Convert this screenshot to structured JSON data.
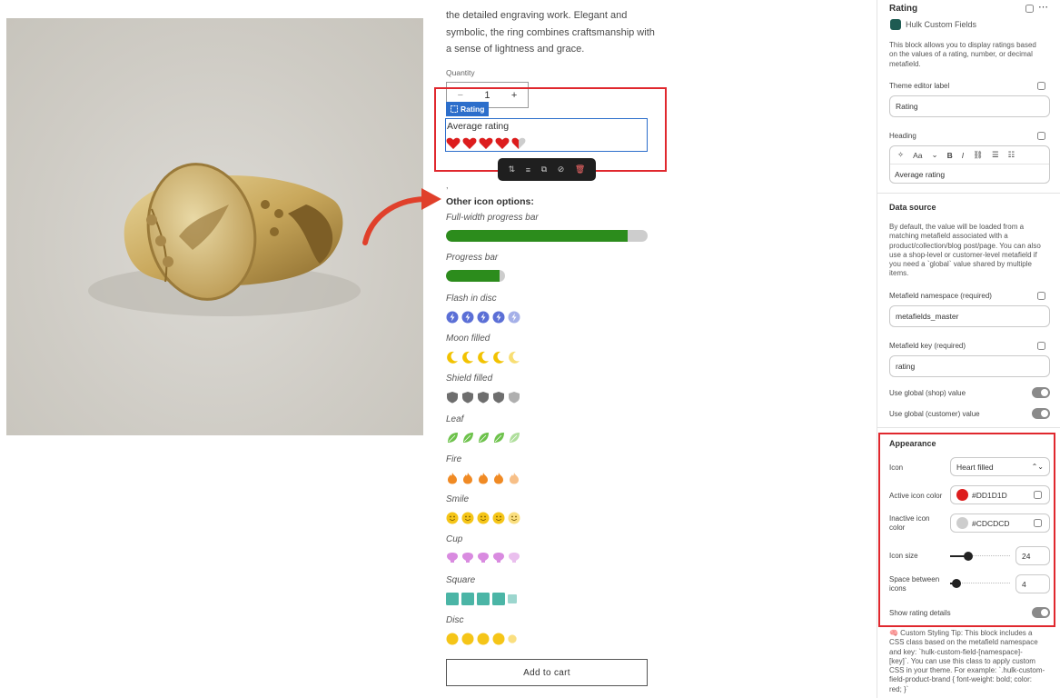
{
  "product": {
    "description_lines": [
      "the detailed engraving work. Elegant and",
      "symbolic, the ring combines craftsmanship with",
      "a sense of lightness and grace."
    ],
    "quantity_label": "Quantity",
    "quantity_value": "1",
    "minus": "−",
    "plus": "+",
    "add_to_cart": "Add to cart"
  },
  "rating_block": {
    "tag": "Rating",
    "heading": "Average rating",
    "rating_value": 4.5,
    "max": 5,
    "active_color": "#DD1D1D",
    "inactive_color": "#CDCDCD"
  },
  "other_options": {
    "heading": "Other icon options:",
    "items": [
      {
        "label": "Full-width progress bar",
        "type": "fullbar",
        "fraction": 0.9
      },
      {
        "label": "Progress bar",
        "type": "bar",
        "fraction": 0.9
      },
      {
        "label": "Flash in disc",
        "type": "flash",
        "color": "#5b6fd6"
      },
      {
        "label": "Moon filled",
        "type": "moon",
        "color": "#f2c200"
      },
      {
        "label": "Shield filled",
        "type": "shield",
        "color": "#6e6e6e"
      },
      {
        "label": "Leaf",
        "type": "leaf",
        "color": "#6dc24b"
      },
      {
        "label": "Fire",
        "type": "fire",
        "color": "#f08a24"
      },
      {
        "label": "Smile",
        "type": "smile",
        "color": "#f5c518"
      },
      {
        "label": "Cup",
        "type": "cup",
        "color": "#d98be0"
      },
      {
        "label": "Square",
        "type": "square",
        "color": "#4bb5a6"
      },
      {
        "label": "Disc",
        "type": "disc",
        "color": "#f5c518"
      }
    ]
  },
  "panel": {
    "title": "Rating",
    "app_name": "Hulk Custom Fields",
    "intro": [
      "This block allows you to display ratings based",
      "on the values of a rating, number, or decimal",
      "metafield."
    ],
    "theme_editor_label": "Theme editor label",
    "theme_editor_value": "Rating",
    "heading_label": "Heading",
    "heading_value": "Average rating",
    "rte_font_label": "Aa",
    "data_source_title": "Data source",
    "data_source_text": [
      "By default, the value will be loaded from a",
      "matching metafield associated with a",
      "product/collection/blog post/page. You can also",
      "use a shop-level or customer-level metafield if",
      "you need a `global` value shared by multiple",
      "items."
    ],
    "namespace_label": "Metafield namespace (required)",
    "namespace_value": "metafields_master",
    "key_label": "Metafield key (required)",
    "key_value": "rating",
    "global_shop_label": "Use global (shop) value",
    "global_customer_label": "Use global (customer) value",
    "appearance_title": "Appearance",
    "icon_label": "Icon",
    "icon_value": "Heart filled",
    "active_color_label": "Active icon color",
    "active_color_value": "#DD1D1D",
    "inactive_color_label": [
      "Inactive icon",
      "color"
    ],
    "inactive_color_value": "#CDCDCD",
    "icon_size_label": "Icon size",
    "icon_size_value": "24",
    "icon_size_fraction": 0.3,
    "space_label": [
      "Space between",
      "icons"
    ],
    "space_value": "4",
    "space_fraction": 0.1,
    "show_details_label": "Show rating details",
    "tip": [
      "🧠 Custom Styling Tip: This block includes a",
      "CSS class based on the metafield namespace",
      "and key: `hulk-custom-field-[namespace]-",
      "[key]`. You can use this class to apply custom",
      "CSS in your theme. For example: `.hulk-custom-",
      "field-product-brand { font-weight: bold; color:",
      "red; }`"
    ]
  }
}
